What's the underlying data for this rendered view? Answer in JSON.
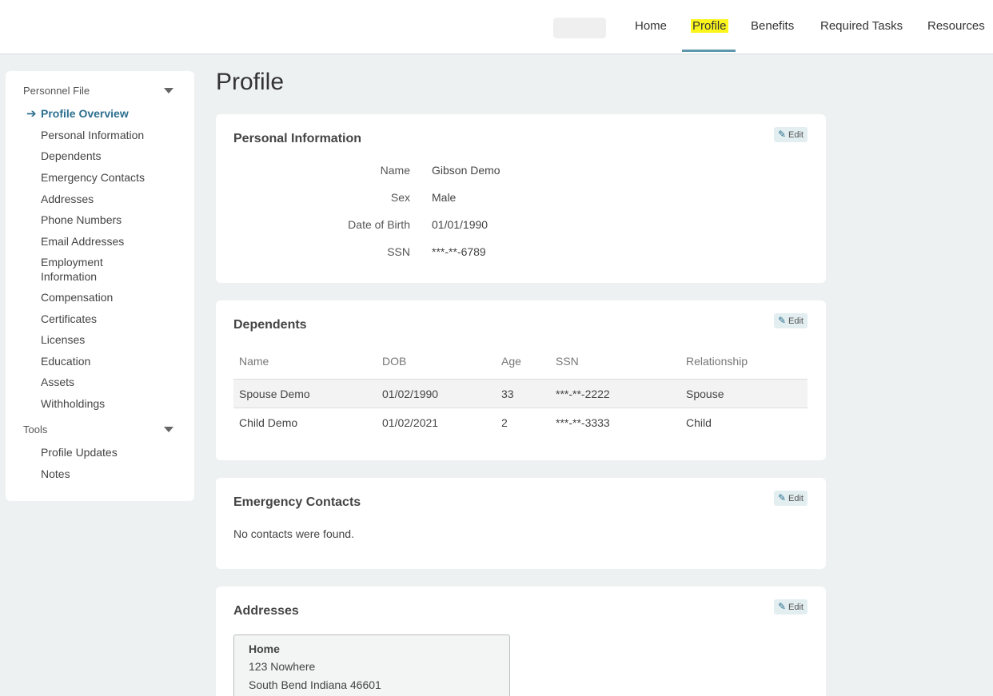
{
  "nav": {
    "items": [
      {
        "label": "Home"
      },
      {
        "label": "Profile"
      },
      {
        "label": "Benefits"
      },
      {
        "label": "Required Tasks"
      },
      {
        "label": "Resources"
      }
    ],
    "active": "Profile",
    "highlight_color": "#fbf51d",
    "underline_color": "#5e97ad"
  },
  "sidebar": {
    "sections": [
      {
        "label": "Personnel File",
        "items": [
          {
            "label": "Profile Overview"
          },
          {
            "label": "Personal Information"
          },
          {
            "label": "Dependents"
          },
          {
            "label": "Emergency Contacts"
          },
          {
            "label": "Addresses"
          },
          {
            "label": "Phone Numbers"
          },
          {
            "label": "Email Addresses"
          },
          {
            "label": "Employment Information"
          },
          {
            "label": "Compensation"
          },
          {
            "label": "Certificates"
          },
          {
            "label": "Licenses"
          },
          {
            "label": "Education"
          },
          {
            "label": "Assets"
          },
          {
            "label": "Withholdings"
          }
        ]
      },
      {
        "label": "Tools",
        "items": [
          {
            "label": "Profile Updates"
          },
          {
            "label": "Notes"
          }
        ]
      }
    ],
    "active_item": "Profile Overview",
    "accent_color": "#2c6f8e"
  },
  "page": {
    "title": "Profile"
  },
  "edit_label": "Edit",
  "personal_info": {
    "title": "Personal Information",
    "fields": [
      {
        "label": "Name",
        "value": "Gibson Demo"
      },
      {
        "label": "Sex",
        "value": "Male"
      },
      {
        "label": "Date of Birth",
        "value": "01/01/1990"
      },
      {
        "label": "SSN",
        "value": "***-**-6789"
      }
    ]
  },
  "dependents": {
    "title": "Dependents",
    "columns": [
      "Name",
      "DOB",
      "Age",
      "SSN",
      "Relationship"
    ],
    "rows": [
      [
        "Spouse Demo",
        "01/02/1990",
        "33",
        "***-**-2222",
        "Spouse"
      ],
      [
        "Child Demo",
        "01/02/2021",
        "2",
        "***-**-3333",
        "Child"
      ]
    ]
  },
  "emergency_contacts": {
    "title": "Emergency Contacts",
    "empty_text": "No contacts were found."
  },
  "addresses": {
    "title": "Addresses",
    "items": [
      {
        "type": "Home",
        "line1": "123 Nowhere",
        "line2": "South Bend Indiana 46601"
      }
    ]
  }
}
